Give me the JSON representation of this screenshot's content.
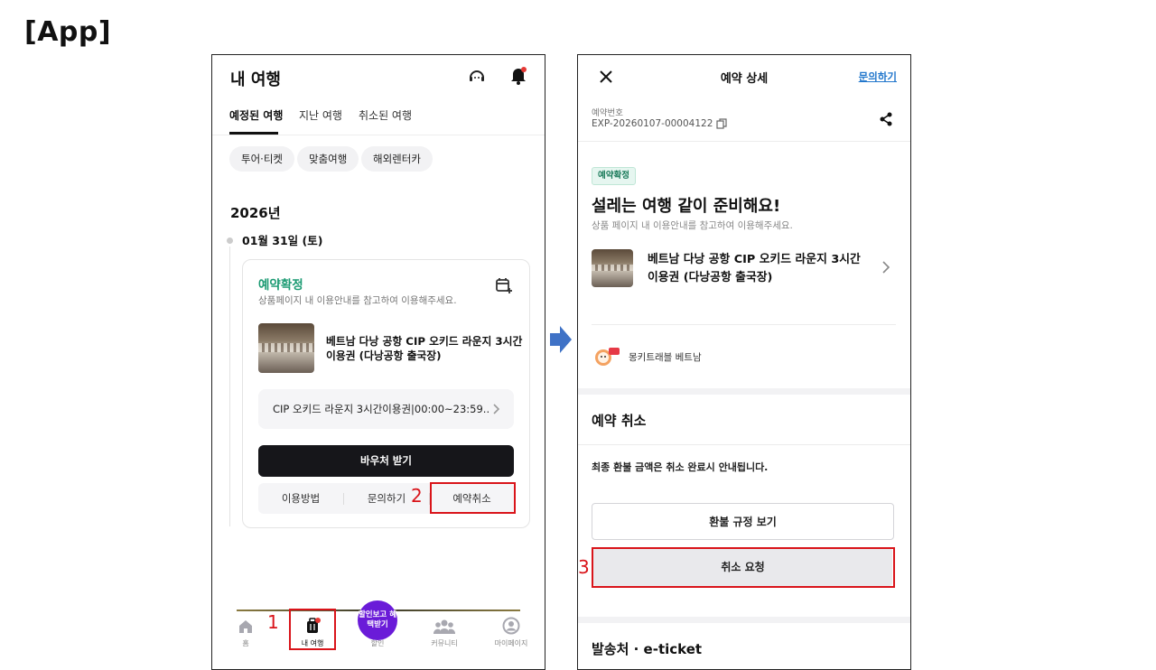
{
  "slide": {
    "title": "[App]"
  },
  "left_phone": {
    "title": "내 여행",
    "tabs": [
      "예정된 여행",
      "지난 여행",
      "취소된 여행"
    ],
    "chips": [
      "투어·티켓",
      "맞춤여행",
      "해외렌터카"
    ],
    "year": "2026년",
    "date": "01월 31일 (토)",
    "card": {
      "status": "예약확정",
      "note": "상품페이지 내 이용안내를 참고하여 이용해주세요.",
      "product_line1": "베트남 다낭 공항 CIP 오키드 라운지 3시간",
      "product_line2": "이용권 (다낭공항 출국장)",
      "option": "CIP 오키드 라운지 3시간이용권|00:00~23:59...",
      "voucher_button": "바우처 받기",
      "actions": [
        "이용방법",
        "문의하기",
        "예약취소"
      ]
    },
    "bottom_nav": {
      "home": "홈",
      "my_trip": "내 여행",
      "promo": "할인보고 혜택받기",
      "discount": "할인",
      "community": "커뮤니티",
      "mypage": "마이페이지"
    }
  },
  "right_phone": {
    "title": "예약 상세",
    "inquiry": "문의하기",
    "reservation_label": "예약번호",
    "reservation_number": "EXP-20260107-00004122",
    "badge": "예약확정",
    "headline": "설레는 여행 같이 준비해요!",
    "subtext": "상품 페이지 내 이용안내를 참고하여 이용해주세요.",
    "product_line1": "베트남 다낭 공항 CIP 오키드 라운지 3시간",
    "product_line2": "이용권 (다낭공항 출국장)",
    "seller": "몽키트래블 베트남",
    "cancel_section_title": "예약 취소",
    "refund_note": "최종 환불 금액은 취소 완료시 안내됩니다.",
    "refund_policy_button": "환불 규정 보기",
    "cancel_request_button": "취소 요청",
    "cut_text": "발송처 · e-ticket"
  },
  "annotations": {
    "step1": "1",
    "step2": "2",
    "step3": "3"
  },
  "colors": {
    "accent_green": "#1a9a72",
    "highlight_red": "#d9141a",
    "promo_purple": "#6a1bd8",
    "link_blue": "#2277cc"
  }
}
